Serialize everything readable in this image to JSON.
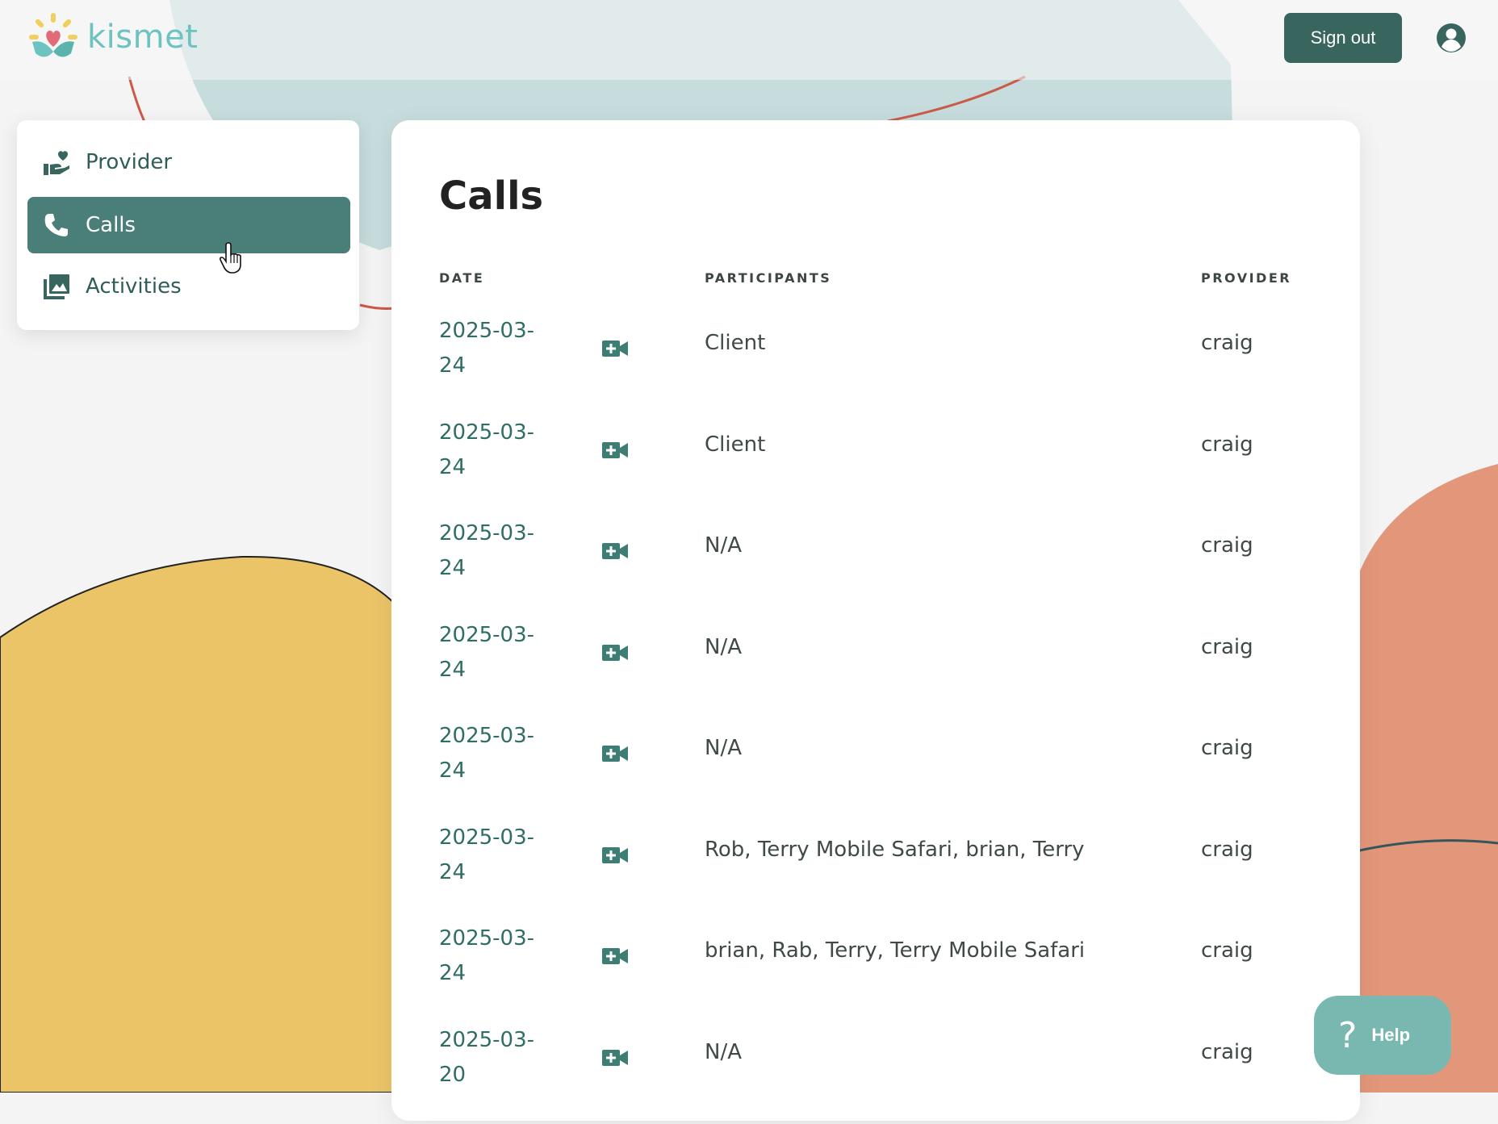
{
  "app": {
    "name": "kismet",
    "accent_color": "#39655f",
    "active_nav_color": "#4a7e78",
    "link_color": "#2f6d65"
  },
  "header": {
    "sign_out_label": "Sign out",
    "account_icon": "account-circle-icon"
  },
  "sidebar": {
    "items": [
      {
        "label": "Provider",
        "icon": "hand-heart-icon",
        "active": false
      },
      {
        "label": "Calls",
        "icon": "phone-icon",
        "active": true
      },
      {
        "label": "Activities",
        "icon": "image-gallery-icon",
        "active": false
      }
    ]
  },
  "main": {
    "title": "Calls",
    "columns": {
      "date": "DATE",
      "participants": "PARTICIPANTS",
      "provider": "PROVIDER"
    },
    "rows": [
      {
        "date_line1": "2025-03-",
        "date_line2": "24",
        "participants": "Client",
        "provider": "craig"
      },
      {
        "date_line1": "2025-03-",
        "date_line2": "24",
        "participants": "Client",
        "provider": "craig"
      },
      {
        "date_line1": "2025-03-",
        "date_line2": "24",
        "participants": "N/A",
        "provider": "craig"
      },
      {
        "date_line1": "2025-03-",
        "date_line2": "24",
        "participants": "N/A",
        "provider": "craig"
      },
      {
        "date_line1": "2025-03-",
        "date_line2": "24",
        "participants": "N/A",
        "provider": "craig"
      },
      {
        "date_line1": "2025-03-",
        "date_line2": "24",
        "participants": "Rob, Terry Mobile Safari, brian, Terry",
        "provider": "craig"
      },
      {
        "date_line1": "2025-03-",
        "date_line2": "24",
        "participants": "brian, Rab, Terry, Terry Mobile Safari",
        "provider": "craig"
      },
      {
        "date_line1": "2025-03-",
        "date_line2": "20",
        "participants": "N/A",
        "provider": "craig"
      }
    ]
  },
  "help": {
    "label": "Help",
    "icon": "question-mark-icon"
  }
}
